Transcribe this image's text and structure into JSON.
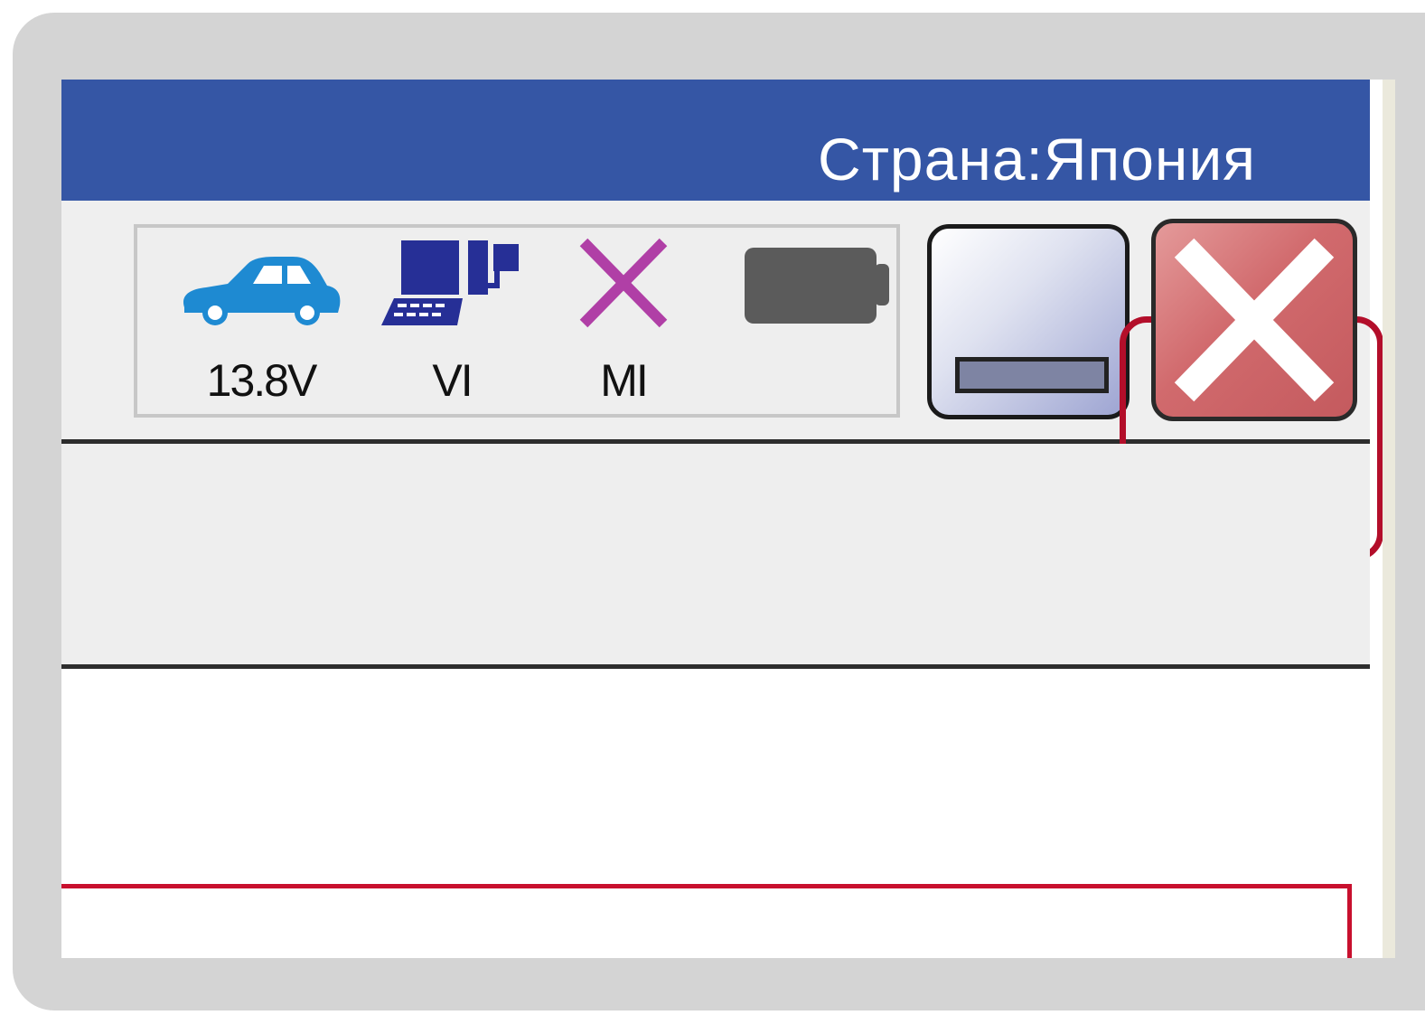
{
  "header": {
    "country_label": "Страна:",
    "country_value": "Япония"
  },
  "status": {
    "vehicle": {
      "icon": "car-icon",
      "label": "13.8V",
      "color": "#1e8ad2"
    },
    "vi": {
      "icon": "computer-icon",
      "label": "VI",
      "color": "#262f96"
    },
    "mi": {
      "icon": "x-mark-icon",
      "label": "MI",
      "color": "#b03fa6"
    },
    "battery": {
      "icon": "battery-icon",
      "color": "#5b5b5b"
    }
  },
  "window_buttons": {
    "minimize_icon": "minimize-icon",
    "close_icon": "close-icon",
    "close_highlight_color": "#b30e2a"
  }
}
